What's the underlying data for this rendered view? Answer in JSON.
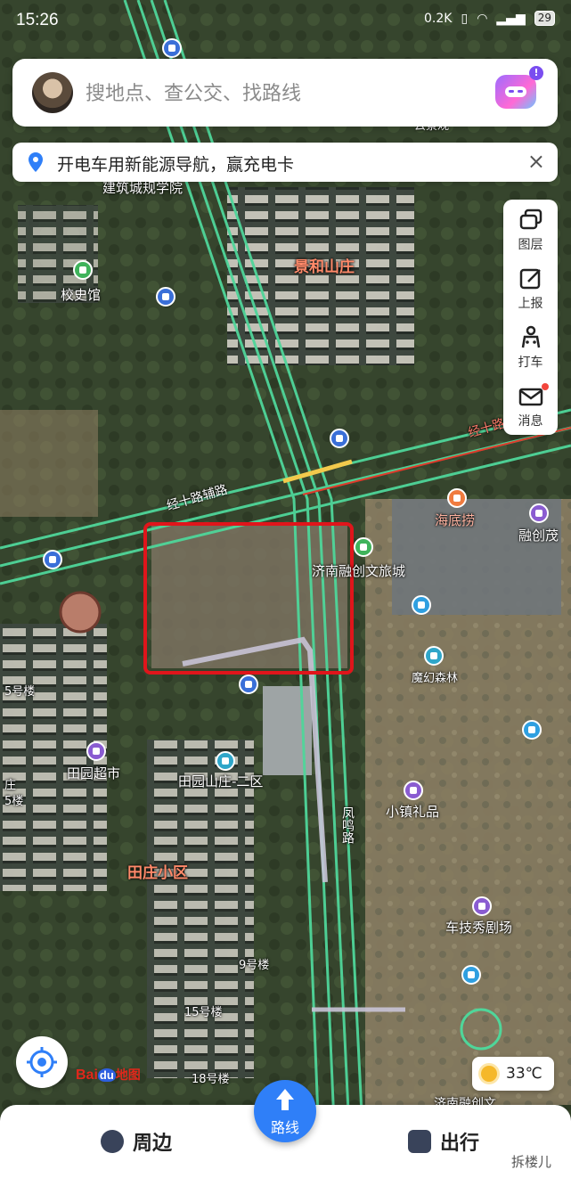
{
  "status_bar": {
    "time": "15:26",
    "net_speed": "0.2K",
    "battery": "29"
  },
  "search": {
    "placeholder": "搜地点、查公交、找路线",
    "assistant_badge": "!"
  },
  "banner": {
    "text": "开电车用新能源导航，赢充电卡",
    "close": "×"
  },
  "tools": [
    {
      "label": "图层",
      "icon": "layers-icon"
    },
    {
      "label": "上报",
      "icon": "report-edit-icon"
    },
    {
      "label": "打车",
      "icon": "taxi-person-icon"
    },
    {
      "label": "消息",
      "icon": "message-envelope-icon"
    }
  ],
  "map_labels": {
    "jinghe": "景和山庄",
    "xiaoshiguan": "校史馆",
    "jianzhu": "建筑城规学院",
    "jingshi_road": "经十路辅路",
    "jingshi_road2": "经十路",
    "haidilao": "海底捞",
    "rongchuang_mao": "融创茂",
    "jinan_city": "济南融创文旅城",
    "mohuan": "魔幻森林",
    "tianyuan_market": "田园超市",
    "tianyuan_2": "田园山庄-二区",
    "fengming": "凤鸣路",
    "xiaozhen": "小镇礼品",
    "tianzhuang": "田庄小区",
    "chejixiu": "车技秀剧场",
    "b5": "5号楼",
    "b9": "9号楼",
    "b15": "15号楼",
    "b18": "18号楼",
    "jinan_rong": "济南融创文",
    "yunjing": "云景观",
    "zhuang": "庄",
    "lou5": "5楼"
  },
  "locate": {
    "icon": "locate-crosshair-icon"
  },
  "logo": {
    "bai": "Bai",
    "du": "du",
    "cn": "地图"
  },
  "weather": {
    "temp": "33℃",
    "icon": "sun-icon"
  },
  "bottom": {
    "nearby": "周边",
    "route": "路线",
    "travel": "出行"
  },
  "watermark": "拆楼儿",
  "colors": {
    "road": "#4fd69a",
    "highlight_box": "#e0151b",
    "accent_blue": "#2f7ff8"
  }
}
